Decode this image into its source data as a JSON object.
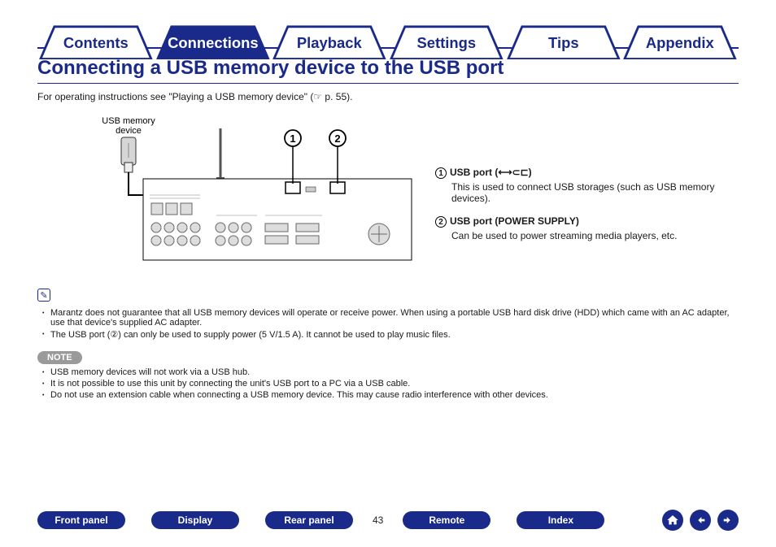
{
  "tabs": [
    {
      "label": "Contents",
      "active": false
    },
    {
      "label": "Connections",
      "active": true
    },
    {
      "label": "Playback",
      "active": false
    },
    {
      "label": "Settings",
      "active": false
    },
    {
      "label": "Tips",
      "active": false
    },
    {
      "label": "Appendix",
      "active": false
    }
  ],
  "title": "Connecting a USB memory device to the USB port",
  "intro": {
    "prefix": "For operating instructions see ",
    "link_text": "\"Playing a USB memory device\"  (☞ p. 55)",
    "suffix": "."
  },
  "diagram": {
    "usb_label_line1": "USB memory",
    "usb_label_line2": "device",
    "callout_marker_1": "1",
    "callout_marker_2": "2"
  },
  "callouts": [
    {
      "num": "1",
      "head": "USB port (⟷⊂⊏)",
      "body": "This is used to connect USB storages (such as USB memory devices)."
    },
    {
      "num": "2",
      "head": "USB port (POWER SUPPLY)",
      "body": "Can be used to power streaming media players, etc."
    }
  ],
  "pencil_notes": [
    "Marantz does not guarantee that all USB memory devices will operate or receive power. When using a portable USB hard disk drive (HDD) which came with an AC adapter, use that device's supplied AC adapter.",
    "The USB port (②) can only be used to supply power (5 V/1.5 A). It cannot be used to play music files."
  ],
  "note": {
    "badge": "NOTE",
    "items": [
      "USB memory devices will not work via a USB hub.",
      "It is not possible to use this unit by connecting the unit's USB port to a PC via a USB cable.",
      "Do not use an extension cable when connecting a USB memory device. This may cause radio interference with other devices."
    ]
  },
  "page_number": "43",
  "bottom_nav": [
    "Front panel",
    "Display",
    "Rear panel",
    "Remote",
    "Index"
  ]
}
